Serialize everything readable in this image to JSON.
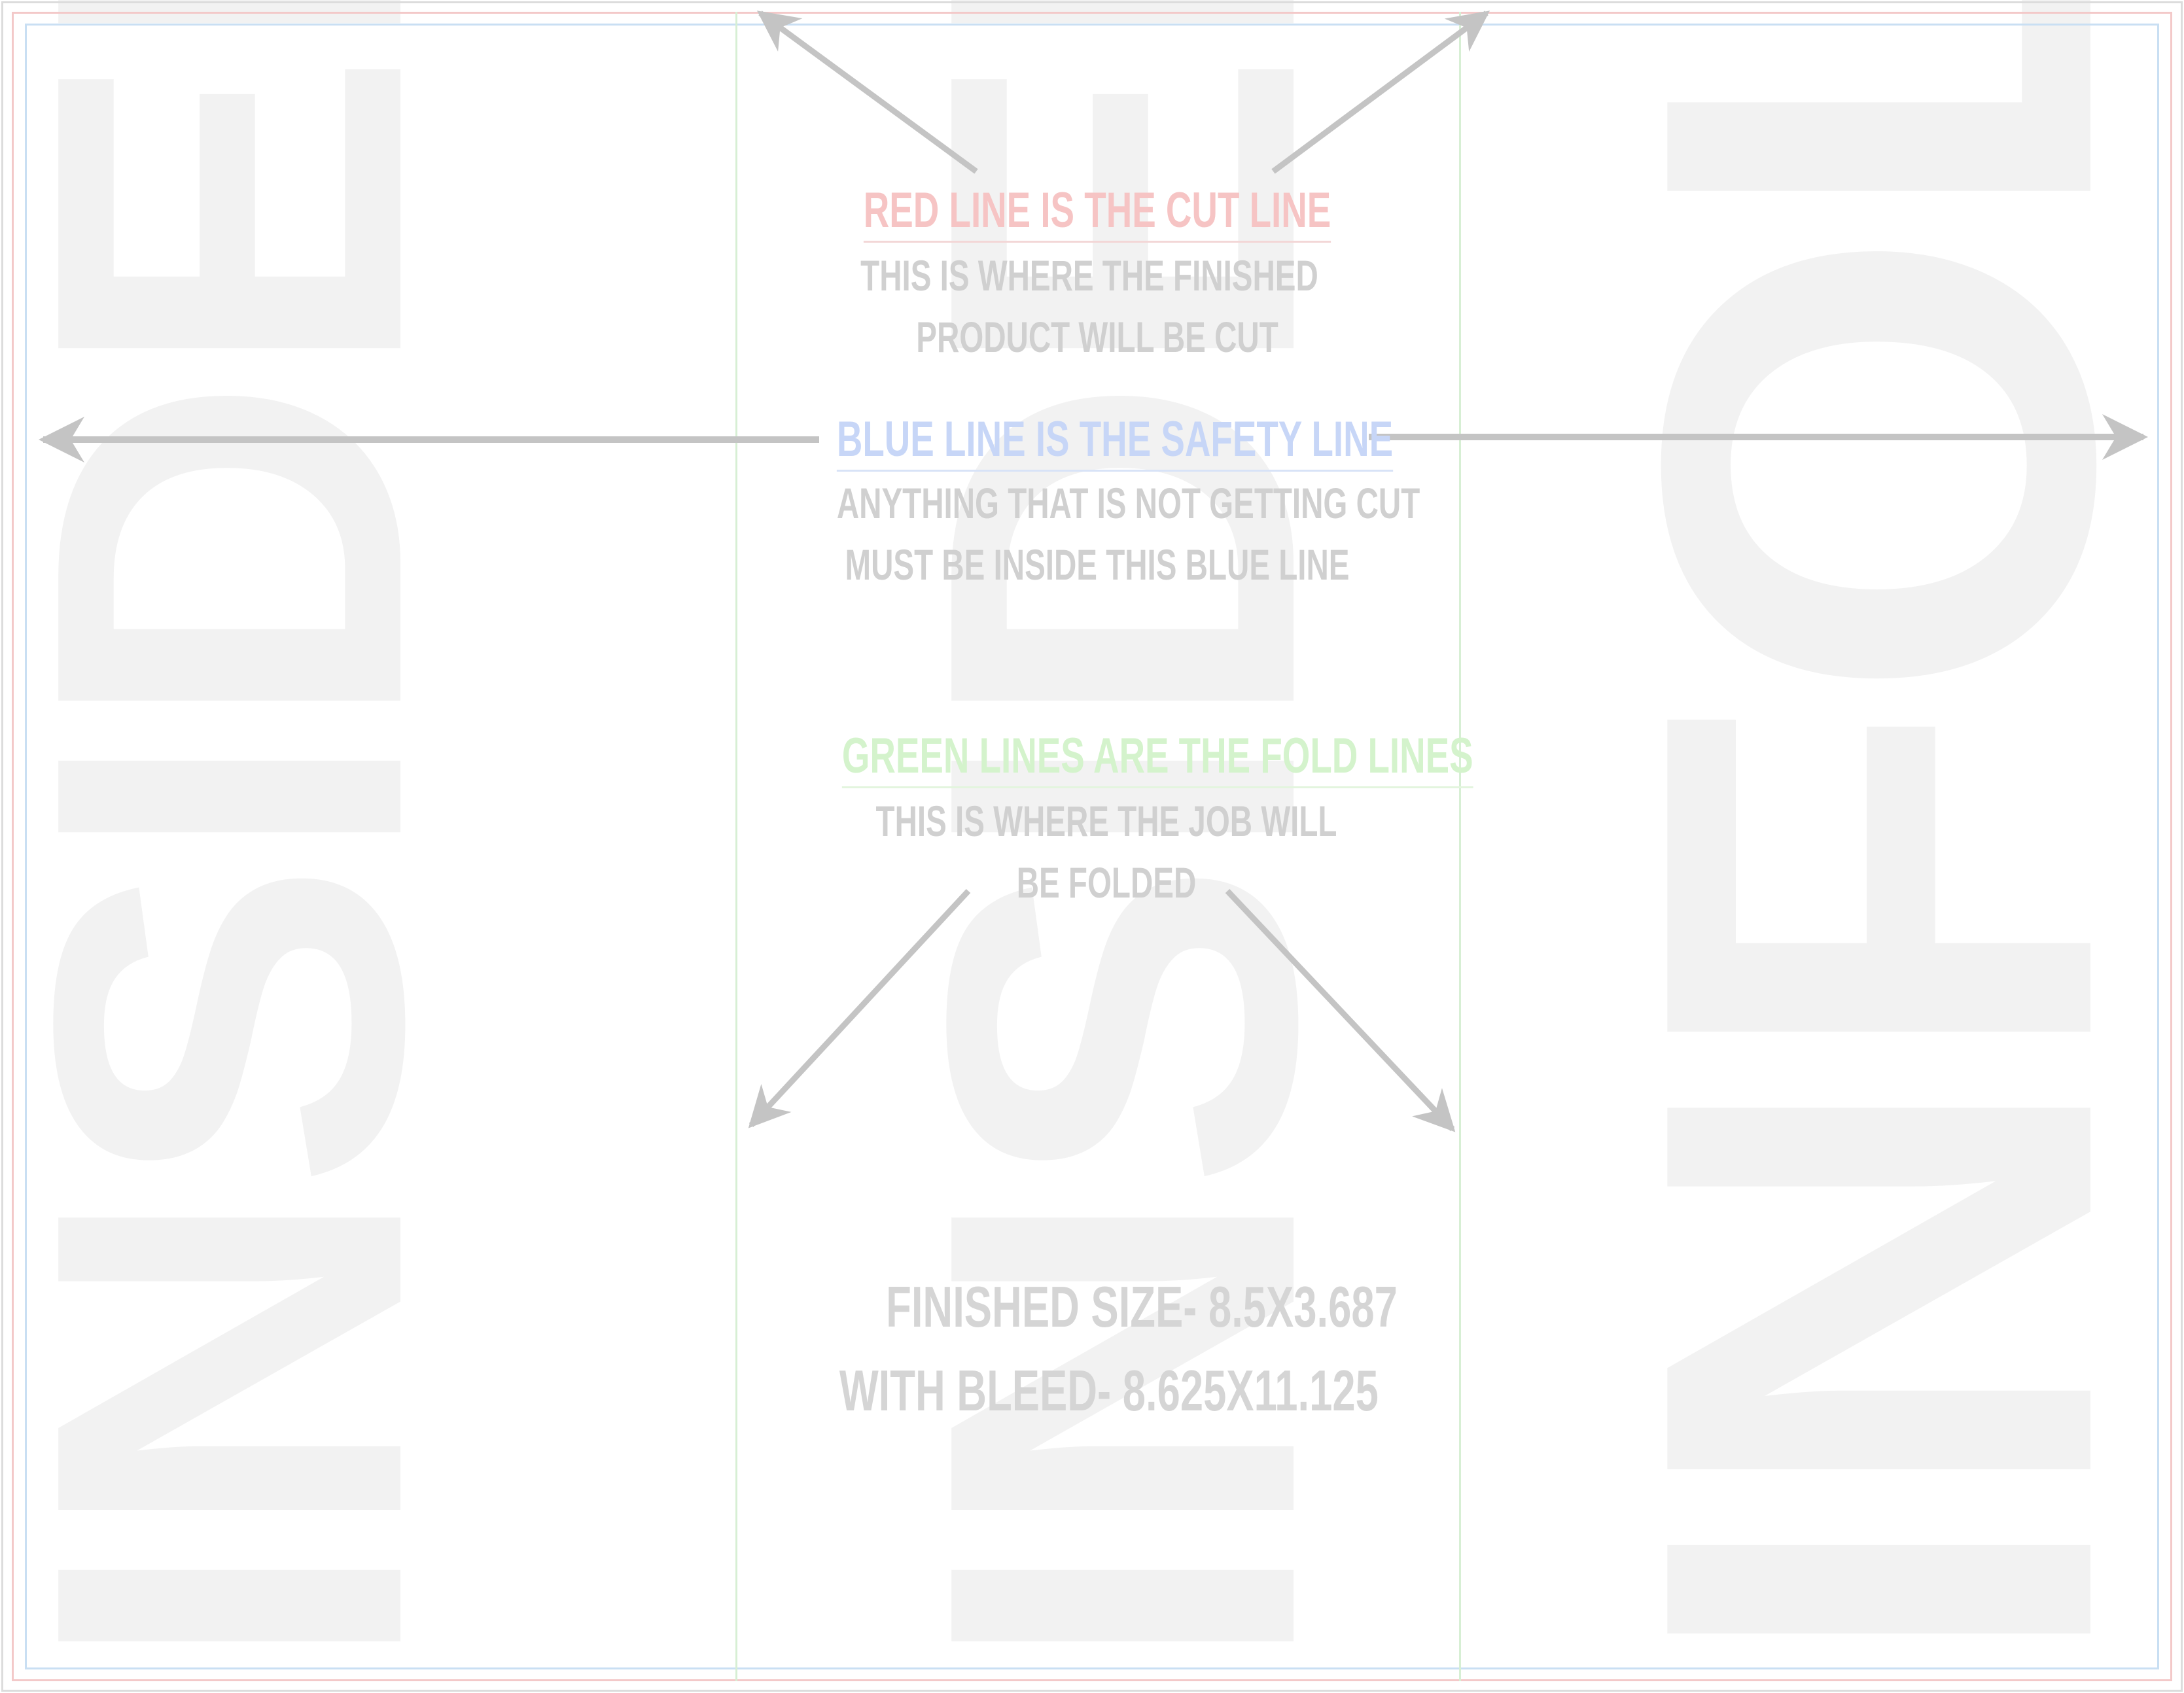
{
  "panels": {
    "left": "INSIDEFR",
    "middle": "INSIDEBK",
    "right": "INFOLD"
  },
  "instructions": {
    "cut": {
      "heading": "RED LINE IS THE CUT LINE",
      "line1": "THIS IS WHERE THE FINISHED",
      "line2": "PRODUCT WILL BE CUT"
    },
    "safety": {
      "heading": "BLUE LINE IS THE SAFETY LINE",
      "line1": "ANYTHING THAT IS NOT GETTING CUT",
      "line2": "MUST BE INSIDE THIS BLUE LINE"
    },
    "fold": {
      "heading": "GREEN LINES ARE THE FOLD LINES",
      "line1": "THIS IS WHERE THE JOB WILL",
      "line2": "BE FOLDED"
    }
  },
  "sizes": {
    "finished": "FINISHED SIZE- 8.5X3.687",
    "bleed": "WITH BLEED- 8.625X11.125"
  },
  "colors": {
    "cut_line": "#f3c9c9",
    "safety_line": "#c9dff3",
    "fold_line": "#d7efd4",
    "arrow": "#c4c4c4",
    "watermark": "#f2f2f2"
  }
}
